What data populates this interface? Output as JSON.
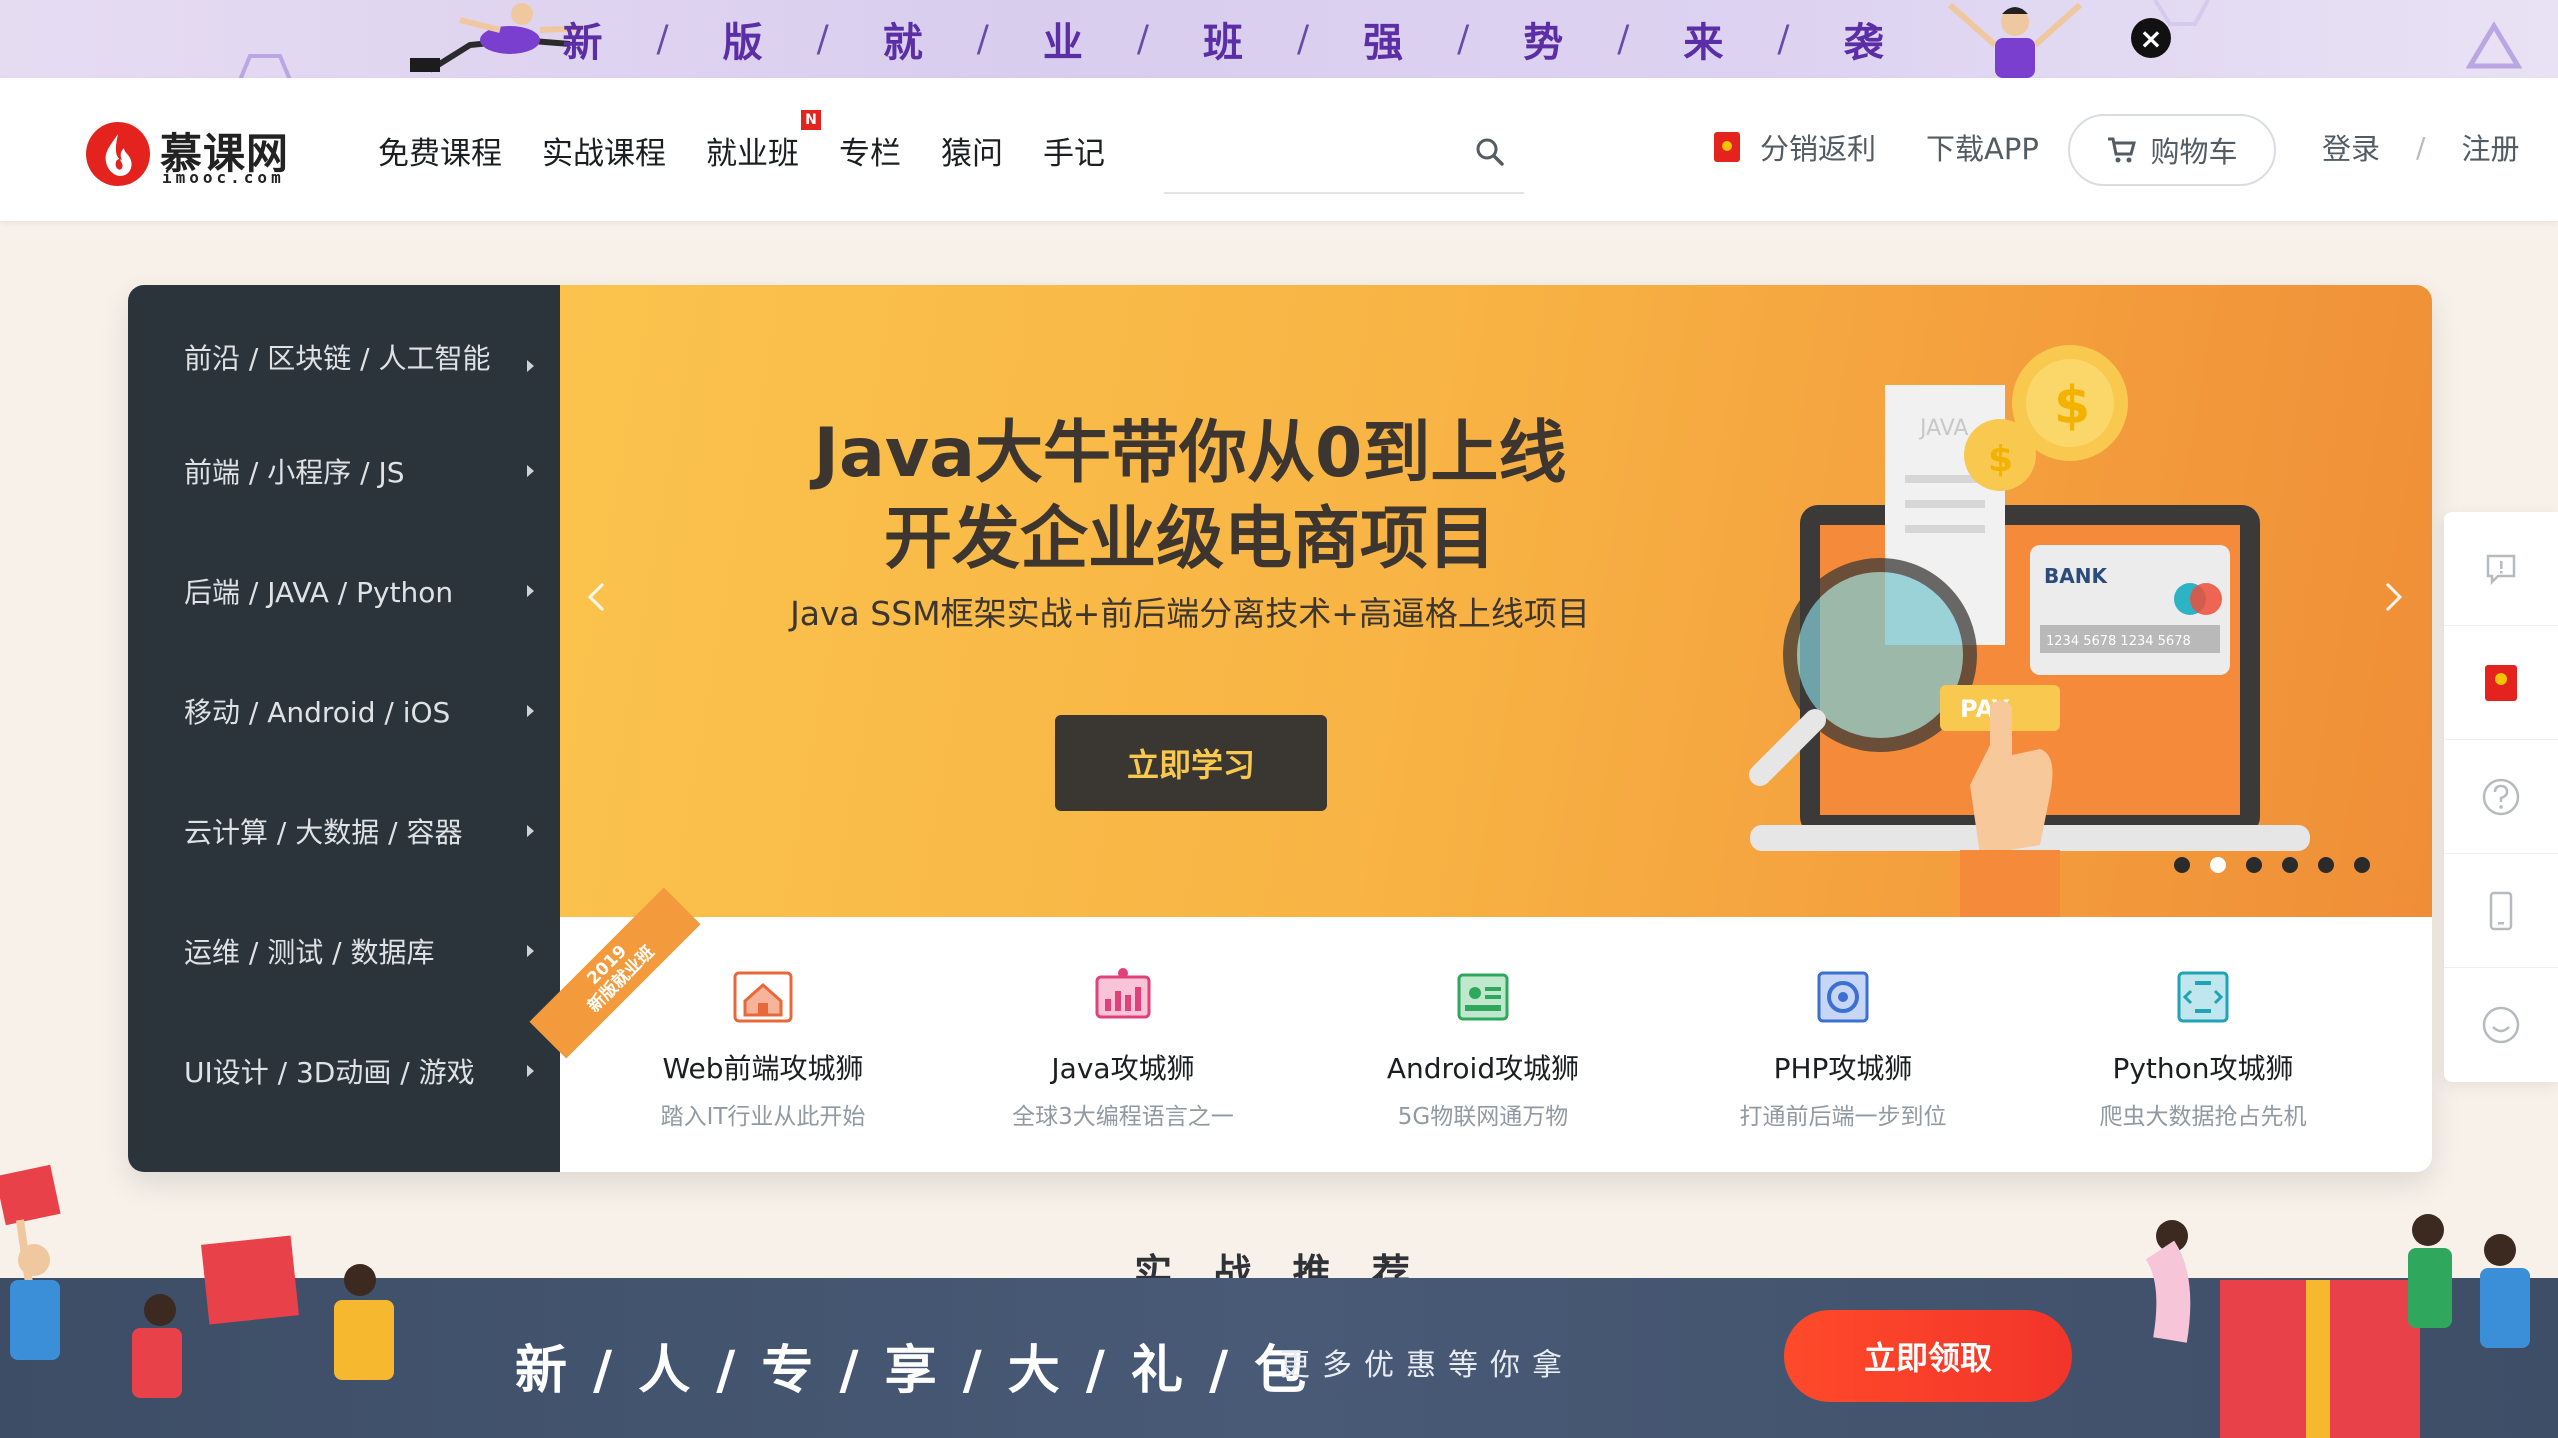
{
  "top_banner": {
    "title_chars": [
      "新",
      "版",
      "就",
      "业",
      "班",
      "强",
      "势",
      "来",
      "袭"
    ],
    "separator": "/",
    "close_icon": "close-icon"
  },
  "header": {
    "logo": {
      "text": "慕课网",
      "sub": "imooc.com"
    },
    "nav": [
      {
        "label": "免费课程"
      },
      {
        "label": "实战课程"
      },
      {
        "label": "就业班",
        "badge": "N"
      },
      {
        "label": "专栏"
      },
      {
        "label": "猿问"
      },
      {
        "label": "手记"
      }
    ],
    "search": {
      "placeholder": "",
      "icon": "search-icon"
    },
    "affiliate_label": "分销返利",
    "download_label": "下载APP",
    "cart_label": "购物车",
    "login_label": "登录",
    "register_label": "注册",
    "separator": "/"
  },
  "side_menu": [
    "前沿 / 区块链 / 人工智能",
    "前端 / 小程序 / JS",
    "后端 / JAVA / Python",
    "移动 / Android / iOS",
    "云计算 / 大数据 / 容器",
    "运维 / 测试 / 数据库",
    "UI设计 / 3D动画 / 游戏"
  ],
  "slide": {
    "headline_line1": "Java大牛带你从0到上线",
    "headline_line2": "开发企业级电商项目",
    "subtitle": "Java SSM框架实战+前后端分离技术+高逼格上线项目",
    "cta_label": "立即学习",
    "illustration": {
      "receipt_text": "JAVA",
      "bank_label": "BANK",
      "card_number": "1234 5678  1234 5678",
      "pay_label": "PAY",
      "coin_symbol": "$"
    },
    "total_slides": 6,
    "active_slide": 2
  },
  "ribbon": {
    "year": "2019",
    "text": "新版就业班"
  },
  "career_paths": [
    {
      "title": "Web前端攻城狮",
      "desc": "踏入IT行业从此开始",
      "color": "#e8683a",
      "icon": "web-house-icon"
    },
    {
      "title": "Java攻城狮",
      "desc": "全球3大编程语言之一",
      "color": "#e0417a",
      "icon": "java-chart-icon"
    },
    {
      "title": "Android攻城狮",
      "desc": "5G物联网通万物",
      "color": "#2fa85e",
      "icon": "android-circuit-icon"
    },
    {
      "title": "PHP攻城狮",
      "desc": "打通前后端一步到位",
      "color": "#3b6fd1",
      "icon": "php-gear-icon"
    },
    {
      "title": "Python攻城狮",
      "desc": "爬虫大数据抢占先机",
      "color": "#1fa3b5",
      "icon": "python-code-icon"
    }
  ],
  "float_bar": [
    "feedback-icon",
    "redpack-icon",
    "help-icon",
    "mobile-icon",
    "chat-icon"
  ],
  "section_title": "实 战 推 荐",
  "bottom_banner": {
    "title": "新 / 人 / 专 / 享 / 大 / 礼 / 包",
    "subtitle": "更多优惠等你拿",
    "cta_label": "立即领取",
    "close_icon": "close-icon"
  },
  "colors": {
    "brand_red": "#e4231e",
    "menu_bg": "#2b333b",
    "slide_orange": "#f8b444",
    "banner_purple": "#5b2ea6",
    "promo_btn": "#f2342a"
  }
}
